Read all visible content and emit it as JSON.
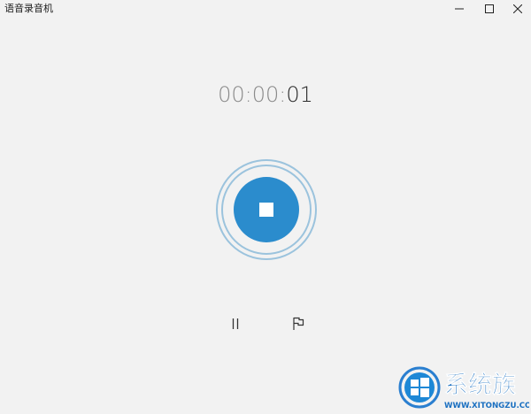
{
  "window": {
    "title": "语音录音机"
  },
  "timer": {
    "dim_part": "00:00:",
    "bright_part": "01"
  },
  "icons": {
    "minimize": "minimize-icon",
    "maximize": "maximize-icon",
    "close": "close-icon",
    "stop": "stop-icon",
    "pause": "pause-icon",
    "flag": "flag-icon"
  },
  "colors": {
    "background": "#f2f2f2",
    "accent": "#2b8ccd",
    "ring": "#9bc3dd",
    "timer_dim": "#8a8a8a",
    "timer_bright": "#2b2b2b"
  },
  "watermark": {
    "brand": "系统族",
    "url": "WWW.XITONGZU.COM"
  }
}
